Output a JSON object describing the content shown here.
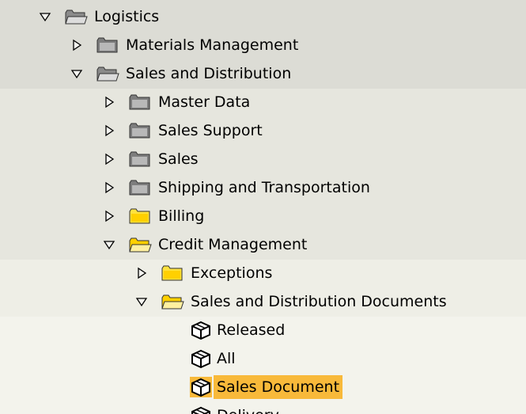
{
  "colors": {
    "level1_bg": "#dcdcd5",
    "level2_bg": "#e6e6de",
    "level3_bg": "#eeeee6",
    "leaf_bg": "#f3f3ec",
    "selection": "#f8b93a",
    "folder_gray": "#7d7d7d",
    "folder_yellow": "#ffe23e"
  },
  "tree": [
    {
      "label": "Logistics",
      "toggle": "expanded",
      "icon": "gray-open-folder-icon"
    },
    {
      "label": "Materials Management",
      "toggle": "collapsed",
      "icon": "gray-folder-icon"
    },
    {
      "label": "Sales and Distribution",
      "toggle": "expanded",
      "icon": "gray-open-folder-icon"
    },
    {
      "label": "Master Data",
      "toggle": "collapsed",
      "icon": "gray-folder-icon"
    },
    {
      "label": "Sales Support",
      "toggle": "collapsed",
      "icon": "gray-folder-icon"
    },
    {
      "label": "Sales",
      "toggle": "collapsed",
      "icon": "gray-folder-icon"
    },
    {
      "label": "Shipping and Transportation",
      "toggle": "collapsed",
      "icon": "gray-folder-icon"
    },
    {
      "label": "Billing",
      "toggle": "collapsed",
      "icon": "yellow-folder-icon"
    },
    {
      "label": "Credit Management",
      "toggle": "expanded",
      "icon": "yellow-open-folder-icon"
    },
    {
      "label": "Exceptions",
      "toggle": "collapsed",
      "icon": "yellow-folder-icon"
    },
    {
      "label": "Sales and Distribution Documents",
      "toggle": "expanded",
      "icon": "yellow-open-folder-icon"
    },
    {
      "label": "Released",
      "icon": "transaction-cube-icon"
    },
    {
      "label": "All",
      "icon": "transaction-cube-icon"
    },
    {
      "label": "Sales Document",
      "icon": "transaction-cube-icon",
      "selected": true
    },
    {
      "label": "Delivery",
      "icon": "transaction-cube-icon"
    }
  ]
}
